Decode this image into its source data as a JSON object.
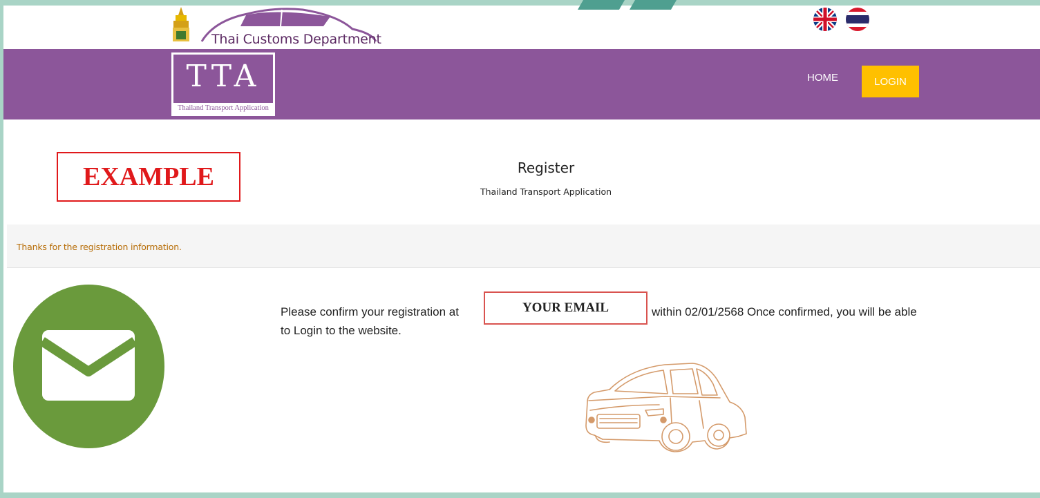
{
  "header": {
    "department_name": "Thai Customs Department",
    "languages": [
      {
        "code": "en",
        "icon": "uk-flag-icon"
      },
      {
        "code": "th",
        "icon": "thai-flag-icon"
      }
    ]
  },
  "navbar": {
    "logo_title": "TTA",
    "logo_subtitle": "Thailand Transport Application",
    "home_label": "HOME",
    "login_label": "LOGIN",
    "bar_color": "#8c569a",
    "login_color": "#ffc000"
  },
  "heading": {
    "example_label": "EXAMPLE",
    "title": "Register",
    "subtitle": "Thailand Transport Application"
  },
  "notice": {
    "text": "Thanks for the registration information."
  },
  "content": {
    "mail_icon": "envelope-icon",
    "confirm_before": "Please confirm your registration at",
    "email_placeholder_label": "YOUR EMAIL",
    "confirm_after": "within 02/01/2568 Once confirmed, you will be able",
    "confirm_line2": "to Login to the website.",
    "car_icon": "car-illustration-icon"
  }
}
